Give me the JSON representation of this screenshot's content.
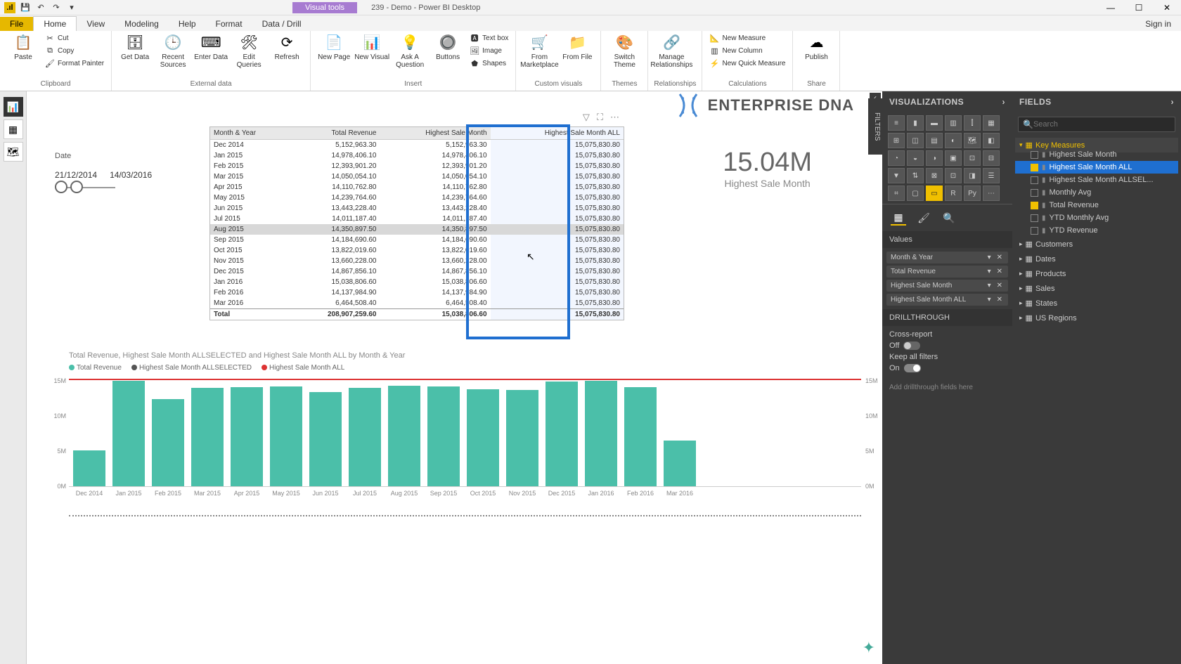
{
  "titlebar": {
    "context_tab": "Visual tools",
    "title": "239 - Demo - Power BI Desktop"
  },
  "menutabs": {
    "file": "File",
    "home": "Home",
    "view": "View",
    "modeling": "Modeling",
    "help": "Help",
    "format": "Format",
    "data_drill": "Data / Drill",
    "signin": "Sign in"
  },
  "ribbon": {
    "paste": "Paste",
    "cut": "Cut",
    "copy": "Copy",
    "format_painter": "Format Painter",
    "clipboard": "Clipboard",
    "get_data": "Get Data",
    "recent_sources": "Recent Sources",
    "enter_data": "Enter Data",
    "edit_queries": "Edit Queries",
    "refresh": "Refresh",
    "external_data": "External data",
    "new_page": "New Page",
    "new_visual": "New Visual",
    "ask": "Ask A Question",
    "buttons": "Buttons",
    "text_box": "Text box",
    "image": "Image",
    "shapes": "Shapes",
    "insert": "Insert",
    "from_marketplace": "From Marketplace",
    "from_file": "From File",
    "custom_visuals": "Custom visuals",
    "switch_theme": "Switch Theme",
    "themes": "Themes",
    "manage_rel": "Manage Relationships",
    "relationships": "Relationships",
    "new_measure": "New Measure",
    "new_column": "New Column",
    "new_quick": "New Quick Measure",
    "calculations": "Calculations",
    "publish": "Publish",
    "share": "Share"
  },
  "canvas_logo": "ENTERPRISE DNA",
  "card": {
    "value": "15.04M",
    "title": "Highest Sale Month"
  },
  "slicer": {
    "label": "Date",
    "from": "21/12/2014",
    "to": "14/03/2016"
  },
  "table": {
    "cols": [
      "Month & Year",
      "Total Revenue",
      "Highest Sale Month",
      "Highest Sale Month ALL"
    ],
    "rows": [
      [
        "Dec 2014",
        "5,152,963.30",
        "5,152,963.30",
        "15,075,830.80"
      ],
      [
        "Jan 2015",
        "14,978,406.10",
        "14,978,406.10",
        "15,075,830.80"
      ],
      [
        "Feb 2015",
        "12,393,901.20",
        "12,393,901.20",
        "15,075,830.80"
      ],
      [
        "Mar 2015",
        "14,050,054.10",
        "14,050,054.10",
        "15,075,830.80"
      ],
      [
        "Apr 2015",
        "14,110,762.80",
        "14,110,762.80",
        "15,075,830.80"
      ],
      [
        "May 2015",
        "14,239,764.60",
        "14,239,764.60",
        "15,075,830.80"
      ],
      [
        "Jun 2015",
        "13,443,228.40",
        "13,443,228.40",
        "15,075,830.80"
      ],
      [
        "Jul 2015",
        "14,011,187.40",
        "14,011,187.40",
        "15,075,830.80"
      ],
      [
        "Aug 2015",
        "14,350,897.50",
        "14,350,897.50",
        "15,075,830.80"
      ],
      [
        "Sep 2015",
        "14,184,690.60",
        "14,184,690.60",
        "15,075,830.80"
      ],
      [
        "Oct 2015",
        "13,822,019.60",
        "13,822,019.60",
        "15,075,830.80"
      ],
      [
        "Nov 2015",
        "13,660,228.00",
        "13,660,228.00",
        "15,075,830.80"
      ],
      [
        "Dec 2015",
        "14,867,856.10",
        "14,867,856.10",
        "15,075,830.80"
      ],
      [
        "Jan 2016",
        "15,038,806.60",
        "15,038,806.60",
        "15,075,830.80"
      ],
      [
        "Feb 2016",
        "14,137,984.90",
        "14,137,984.90",
        "15,075,830.80"
      ],
      [
        "Mar 2016",
        "6,464,508.40",
        "6,464,508.40",
        "15,075,830.80"
      ]
    ],
    "total": [
      "Total",
      "208,907,259.60",
      "15,038,806.60",
      "15,075,830.80"
    ]
  },
  "chart_data": {
    "type": "bar",
    "title": "Total Revenue, Highest Sale Month ALLSELECTED and Highest Sale Month ALL by Month & Year",
    "legend": [
      "Total Revenue",
      "Highest Sale Month ALLSELECTED",
      "Highest Sale Month ALL"
    ],
    "legend_colors": [
      "#4bbfa9",
      "#555",
      "#d33"
    ],
    "categories": [
      "Dec 2014",
      "Jan 2015",
      "Feb 2015",
      "Mar 2015",
      "Apr 2015",
      "May 2015",
      "Jun 2015",
      "Jul 2015",
      "Aug 2015",
      "Sep 2015",
      "Oct 2015",
      "Nov 2015",
      "Dec 2015",
      "Jan 2016",
      "Feb 2016",
      "Mar 2016"
    ],
    "values_M": [
      5.15,
      14.98,
      12.39,
      14.05,
      14.11,
      14.24,
      13.44,
      14.01,
      14.35,
      14.18,
      13.82,
      13.66,
      14.87,
      15.04,
      14.14,
      6.46
    ],
    "ref_allselected_M": 15.04,
    "ref_all_M": 15.08,
    "ylim": [
      0,
      15
    ],
    "yticks": [
      "0M",
      "5M",
      "10M",
      "15M"
    ],
    "yticks2": [
      "0M",
      "5M",
      "10M",
      "15M"
    ]
  },
  "viz_pane": {
    "title": "VISUALIZATIONS",
    "values_label": "Values",
    "wells": [
      "Month & Year",
      "Total Revenue",
      "Highest Sale Month",
      "Highest Sale Month ALL"
    ],
    "drillthrough": "DRILLTHROUGH",
    "cross_report": "Cross-report",
    "off": "Off",
    "keep_filters": "Keep all filters",
    "on": "On",
    "hint": "Add drillthrough fields here"
  },
  "fields_pane": {
    "title": "FIELDS",
    "search": "Search",
    "filters_tab": "FILTERS",
    "key_measures": "Key Measures",
    "fields": [
      {
        "name": "Highest Sale Month",
        "checked": false,
        "hl": false
      },
      {
        "name": "Highest Sale Month ALL",
        "checked": true,
        "hl": true
      },
      {
        "name": "Highest Sale Month ALLSEL...",
        "checked": false,
        "hl": false
      },
      {
        "name": "Monthly Avg",
        "checked": false,
        "hl": false
      },
      {
        "name": "Total Revenue",
        "checked": true,
        "hl": false
      },
      {
        "name": "YTD Monthly Avg",
        "checked": false,
        "hl": false
      },
      {
        "name": "YTD Revenue",
        "checked": false,
        "hl": false
      }
    ],
    "tables": [
      "Customers",
      "Dates",
      "Products",
      "Sales",
      "States",
      "US Regions"
    ]
  }
}
